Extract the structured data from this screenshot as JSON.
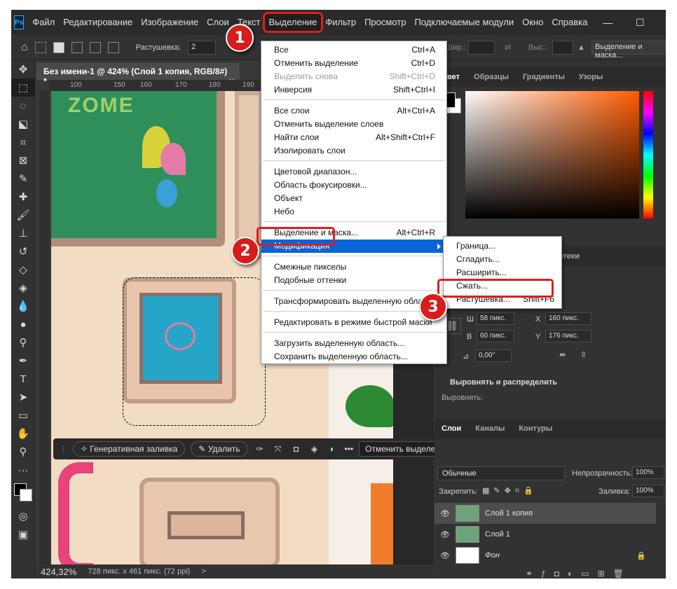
{
  "app": {
    "logo": "Ps",
    "menu": [
      "Файл",
      "Редактирование",
      "Изображение",
      "Слои",
      "Текст",
      "Выделение",
      "Фильтр",
      "Просмотр",
      "Подключаемые модули",
      "Окно",
      "Справка"
    ],
    "window_controls": [
      "—",
      "☐",
      "✕"
    ]
  },
  "options_bar": {
    "feather_label": "Растушевка:",
    "feather_value": "2",
    "width_label": "Шир.:",
    "height_label": "Выс.:",
    "select_mask_button": "Выделение и маска..."
  },
  "document": {
    "tab_title": "Без имени-1 @ 424% (Слой 1 копия, RGB/8#) *",
    "tab_close": "×",
    "ruler_ticks": [
      "100",
      "150",
      "160",
      "170",
      "180",
      "190"
    ],
    "zoom": "424,32%",
    "doc_info": "728 пикс. x 461 пикс. (72 ppi)",
    "canvas_text": "ZOME"
  },
  "context_bar": {
    "generative_fill": "Генеративная заливка",
    "delete": "Удалить",
    "more": "•••",
    "deselect": "Отменить выделение"
  },
  "select_menu": {
    "groups": [
      [
        {
          "label": "Все",
          "shortcut": "Ctrl+A",
          "disabled": false
        },
        {
          "label": "Отменить выделение",
          "shortcut": "Ctrl+D",
          "disabled": false
        },
        {
          "label": "Выделить снова",
          "shortcut": "Shift+Ctrl+D",
          "disabled": true
        },
        {
          "label": "Инверсия",
          "shortcut": "Shift+Ctrl+I",
          "disabled": false
        }
      ],
      [
        {
          "label": "Все слои",
          "shortcut": "Alt+Ctrl+A",
          "disabled": false
        },
        {
          "label": "Отменить выделение слоев",
          "shortcut": "",
          "disabled": false
        },
        {
          "label": "Найти слои",
          "shortcut": "Alt+Shift+Ctrl+F",
          "disabled": false
        },
        {
          "label": "Изолировать слои",
          "shortcut": "",
          "disabled": false
        }
      ],
      [
        {
          "label": "Цветовой диапазон...",
          "shortcut": "",
          "disabled": false
        },
        {
          "label": "Область фокусировки...",
          "shortcut": "",
          "disabled": false
        },
        {
          "label": "Объект",
          "shortcut": "",
          "disabled": false
        },
        {
          "label": "Небо",
          "shortcut": "",
          "disabled": false
        }
      ],
      [
        {
          "label": "Выделение и маска...",
          "shortcut": "Alt+Ctrl+R",
          "disabled": false
        },
        {
          "label": "Модификация",
          "shortcut": "",
          "disabled": false,
          "active": true,
          "submenu": true
        }
      ],
      [
        {
          "label": "Смежные пикселы",
          "shortcut": "",
          "disabled": false
        },
        {
          "label": "Подобные оттенки",
          "shortcut": "",
          "disabled": false
        }
      ],
      [
        {
          "label": "Трансформировать выделенную область",
          "shortcut": "",
          "disabled": false
        }
      ],
      [
        {
          "label": "Редактировать в режиме быстрой маски",
          "shortcut": "",
          "disabled": false
        }
      ],
      [
        {
          "label": "Загрузить выделенную область...",
          "shortcut": "",
          "disabled": false
        },
        {
          "label": "Сохранить выделенную область...",
          "shortcut": "",
          "disabled": false
        }
      ]
    ]
  },
  "modify_submenu": [
    {
      "label": "Граница...",
      "shortcut": ""
    },
    {
      "label": "Сгладить...",
      "shortcut": ""
    },
    {
      "label": "Расширить...",
      "shortcut": ""
    },
    {
      "label": "Сжать...",
      "shortcut": ""
    },
    {
      "label": "Растушевка...",
      "shortcut": "Shift+F6"
    }
  ],
  "step_badges": [
    "1",
    "2",
    "3"
  ],
  "color_panel": {
    "tabs": [
      "Цвет",
      "Образцы",
      "Градиенты",
      "Узоры"
    ]
  },
  "properties_panel": {
    "tab_partial": "иотеки",
    "w_label": "Ш",
    "w_value": "58 пикс.",
    "h_label": "В",
    "h_value": "60 пикс.",
    "x_label": "X",
    "x_value": "160 пикс.",
    "y_label": "Y",
    "y_value": "176 пикс.",
    "angle_value": "0,00°",
    "align_header": "Выровнять и распределить",
    "align_label": "Выровнять:"
  },
  "layers_panel": {
    "tabs": [
      "Слои",
      "Каналы",
      "Контуры"
    ],
    "blend_mode": "Обычные",
    "opacity_label": "Непрозрачность:",
    "opacity_value": "100%",
    "lock_label": "Закрепить:",
    "fill_label": "Заливка:",
    "fill_value": "100%",
    "layers": [
      {
        "name": "Слой 1 копия",
        "selected": true
      },
      {
        "name": "Слой 1",
        "selected": false
      },
      {
        "name": "Фон",
        "selected": false,
        "locked": true
      }
    ]
  },
  "colors": {
    "menu_highlight": "#0a64d6",
    "annotation_red": "#e01e1e"
  }
}
